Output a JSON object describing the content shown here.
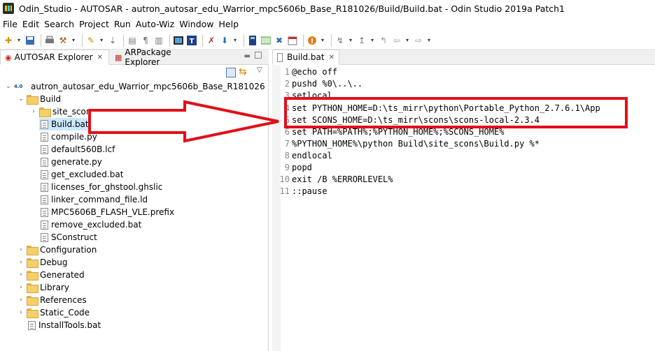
{
  "window": {
    "title": "Odin_Studio - AUTOSAR - autron_autosar_edu_Warrior_mpc5606b_Base_R181026/Build/Build.bat - Odin Studio 2019a Patch1"
  },
  "menu": [
    "File",
    "Edit",
    "Search",
    "Project",
    "Run",
    "Auto-Wiz",
    "Window",
    "Help"
  ],
  "explorer": {
    "tabs": [
      {
        "label": "AUTOSAR Explorer"
      },
      {
        "label": "ARPackage Explorer"
      }
    ],
    "project_badge": "4.0",
    "tree": [
      {
        "label": "autron_autosar_edu_Warrior_mpc5606b_Base_R181026",
        "kind": "project",
        "expanded": true
      },
      {
        "label": "Build",
        "kind": "folder",
        "expanded": true
      },
      {
        "label": "site_scons",
        "kind": "folder",
        "expanded": false
      },
      {
        "label": "Build.bat",
        "kind": "file",
        "selected": true
      },
      {
        "label": "compile.py",
        "kind": "file"
      },
      {
        "label": "default560B.lcf",
        "kind": "file"
      },
      {
        "label": "generate.py",
        "kind": "file"
      },
      {
        "label": "get_excluded.bat",
        "kind": "file"
      },
      {
        "label": "licenses_for_ghstool.ghslic",
        "kind": "file"
      },
      {
        "label": "linker_command_file.ld",
        "kind": "file"
      },
      {
        "label": "MPC5606B_FLASH_VLE.prefix",
        "kind": "file"
      },
      {
        "label": "remove_excluded.bat",
        "kind": "file"
      },
      {
        "label": "SConstruct",
        "kind": "file"
      },
      {
        "label": "Configuration",
        "kind": "folder",
        "expanded": false
      },
      {
        "label": "Debug",
        "kind": "folder",
        "expanded": false
      },
      {
        "label": "Generated",
        "kind": "folder",
        "expanded": false
      },
      {
        "label": "Library",
        "kind": "folder",
        "expanded": false
      },
      {
        "label": "References",
        "kind": "folder",
        "expanded": false
      },
      {
        "label": "Static_Code",
        "kind": "folder",
        "expanded": false
      },
      {
        "label": "InstallTools.bat",
        "kind": "file"
      }
    ]
  },
  "editor": {
    "tab_label": "Build.bat",
    "lines": [
      {
        "n": "1",
        "text": "@echo off"
      },
      {
        "n": "2",
        "text": "pushd %0\\..\\.."
      },
      {
        "n": "3",
        "text": "setlocal"
      },
      {
        "n": "4",
        "text": "set PYTHON_HOME=D:\\ts_mirr\\python\\Portable_Python_2.7.6.1\\App"
      },
      {
        "n": "5",
        "text": "set SCONS_HOME=D:\\ts_mirr\\scons\\scons-local-2.3.4"
      },
      {
        "n": "6",
        "text": "set PATH=%PATH%;%PYTHON_HOME%;%SCONS_HOME%"
      },
      {
        "n": "7",
        "text": "%PYTHON_HOME%\\python Build\\site_scons\\Build.py %*"
      },
      {
        "n": "8",
        "text": "endlocal"
      },
      {
        "n": "9",
        "text": "popd"
      },
      {
        "n": "10",
        "text": "exit /B %ERRORLEVEL%"
      },
      {
        "n": "11",
        "text": "::pause"
      }
    ]
  },
  "annotation": {
    "color": "#e0101a"
  }
}
